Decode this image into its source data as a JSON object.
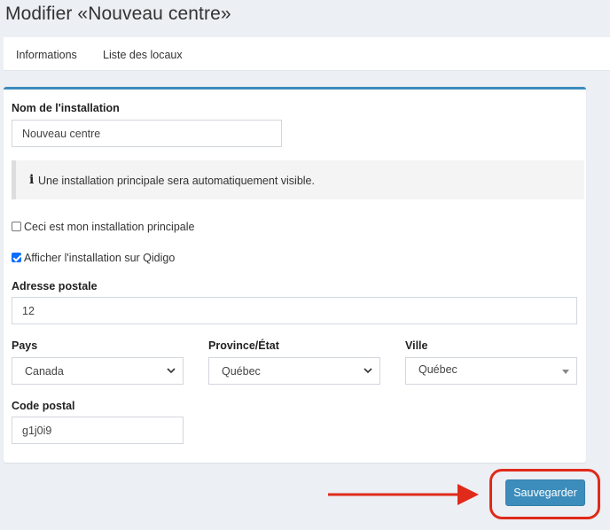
{
  "page": {
    "title": "Modifier «Nouveau centre»"
  },
  "tabs": [
    {
      "label": "Informations"
    },
    {
      "label": "Liste des locaux"
    }
  ],
  "form": {
    "name": {
      "label": "Nom de l'installation",
      "value": "Nouveau centre"
    },
    "callout": {
      "icon": "info-icon",
      "text": "Une installation principale sera automatiquement visible."
    },
    "main_installation": {
      "label": "Ceci est mon installation principale",
      "checked": false
    },
    "show_on_qidigo": {
      "label": "Afficher l'installation sur Qidigo",
      "checked": true
    },
    "address": {
      "label": "Adresse postale",
      "value": "12"
    },
    "country": {
      "label": "Pays",
      "value": "Canada"
    },
    "province": {
      "label": "Province/État",
      "value": "Québec"
    },
    "city": {
      "label": "Ville",
      "value": "Québec"
    },
    "postal_code": {
      "label": "Code postal",
      "value": "g1j0i9"
    },
    "save_label": "Sauvegarder"
  },
  "annotation": {
    "color": "#e02a1a"
  },
  "colors": {
    "accent": "#3c8dbc",
    "checkbox": "#0d6efd"
  }
}
